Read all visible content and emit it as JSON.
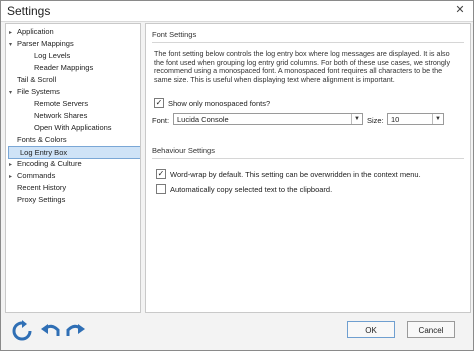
{
  "window": {
    "title": "Settings"
  },
  "tree": [
    {
      "label": "Application",
      "level": 0,
      "toggle": "▸",
      "selected": false
    },
    {
      "label": "Parser Mappings",
      "level": 0,
      "toggle": "▾",
      "selected": false
    },
    {
      "label": "Log Levels",
      "level": 1,
      "toggle": "",
      "selected": false
    },
    {
      "label": "Reader Mappings",
      "level": 1,
      "toggle": "",
      "selected": false
    },
    {
      "label": "Tail & Scroll",
      "level": 0,
      "toggle": "",
      "selected": false
    },
    {
      "label": "File Systems",
      "level": 0,
      "toggle": "▾",
      "selected": false
    },
    {
      "label": "Remote Servers",
      "level": 1,
      "toggle": "",
      "selected": false
    },
    {
      "label": "Network Shares",
      "level": 1,
      "toggle": "",
      "selected": false
    },
    {
      "label": "Open With Applications",
      "level": 1,
      "toggle": "",
      "selected": false
    },
    {
      "label": "Fonts & Colors",
      "level": 0,
      "toggle": "",
      "selected": false
    },
    {
      "label": "Log Entry Box",
      "level": 0,
      "toggle": "",
      "selected": true
    },
    {
      "label": "Encoding & Culture",
      "level": 0,
      "toggle": "▸",
      "selected": false
    },
    {
      "label": "Commands",
      "level": 0,
      "toggle": "▸",
      "selected": false
    },
    {
      "label": "Recent History",
      "level": 0,
      "toggle": "",
      "selected": false
    },
    {
      "label": "Proxy Settings",
      "level": 0,
      "toggle": "",
      "selected": false
    }
  ],
  "font_settings": {
    "header": "Font Settings",
    "description": "The font setting below controls the log entry box where log messages are displayed.  It is also the font used when grouping log entry grid columns.  For both of these use cases, we strongly recommend using a monospaced font.  A monospaced font requires all characters to be the same size.  This is useful when displaying text where alignment is important.",
    "monospaced_label": "Show only monospaced fonts?",
    "monospaced_checked": true,
    "font_label": "Font:",
    "font_value": "Lucida Console",
    "size_label": "Size:",
    "size_value": "10"
  },
  "behaviour_settings": {
    "header": "Behaviour Settings",
    "wordwrap_label": "Word-wrap by default.  This setting can be overwridden in the context menu.",
    "wordwrap_checked": true,
    "autocopy_label": "Automatically copy selected text to the clipboard.",
    "autocopy_checked": false
  },
  "footer": {
    "ok_label": "OK",
    "cancel_label": "Cancel"
  },
  "colors": {
    "accent": "#2f6fb5",
    "selection": "#cfe3f7"
  },
  "icons": [
    "reset-icon",
    "undo-icon",
    "redo-icon",
    "close-icon"
  ]
}
